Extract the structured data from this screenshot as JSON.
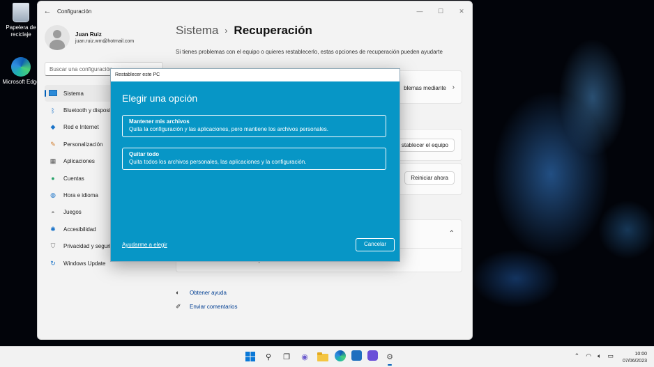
{
  "desktop": {
    "recycle_bin_label": "Papelera de reciclaje",
    "edge_label": "Microsoft Edge"
  },
  "window": {
    "title": "Configuración",
    "user": {
      "name": "Juan Ruiz",
      "email": "juan.ruiz.wm@hotmail.com"
    },
    "search_placeholder": "Buscar una configuración",
    "nav": [
      {
        "label": "Sistema",
        "icon": "monitor-icon"
      },
      {
        "label": "Bluetooth y dispositivos",
        "icon": "bluetooth-icon"
      },
      {
        "label": "Red e Internet",
        "icon": "wifi-icon"
      },
      {
        "label": "Personalización",
        "icon": "brush-icon"
      },
      {
        "label": "Aplicaciones",
        "icon": "apps-icon"
      },
      {
        "label": "Cuentas",
        "icon": "person-icon"
      },
      {
        "label": "Hora e idioma",
        "icon": "globe-icon"
      },
      {
        "label": "Juegos",
        "icon": "gamepad-icon"
      },
      {
        "label": "Accesibilidad",
        "icon": "accessibility-icon"
      },
      {
        "label": "Privacidad y seguridad",
        "icon": "shield-icon"
      },
      {
        "label": "Windows Update",
        "icon": "update-icon"
      }
    ],
    "breadcrumb": {
      "parent": "Sistema",
      "current": "Recuperación"
    },
    "description": "Si tienes problemas con el equipo o quieres restablecerlo, estas opciones de recuperación pueden ayudarte",
    "card1_text": "blemas mediante",
    "reset_button": "stablecer el equipo",
    "restart_button": "Reiniciar ahora",
    "card4_text": "ete una unidad de recuperación",
    "links": {
      "help": "Obtener ayuda",
      "feedback": "Enviar comentarios"
    }
  },
  "dialog": {
    "title": "Restablecer este PC",
    "heading": "Elegir una opción",
    "option1": {
      "title": "Mantener mis archivos",
      "desc": "Quita la configuración y las aplicaciones, pero mantiene los archivos personales."
    },
    "option2": {
      "title": "Quitar todo",
      "desc": "Quita todos los archivos personales, las aplicaciones y la configuración."
    },
    "help_link": "Ayudarme a elegir",
    "cancel": "Cancelar"
  },
  "taskbar": {
    "time": "10:00",
    "date": "07/06/2023"
  },
  "colors": {
    "accent": "#005fb8",
    "dialog_bg": "#0796c6"
  }
}
